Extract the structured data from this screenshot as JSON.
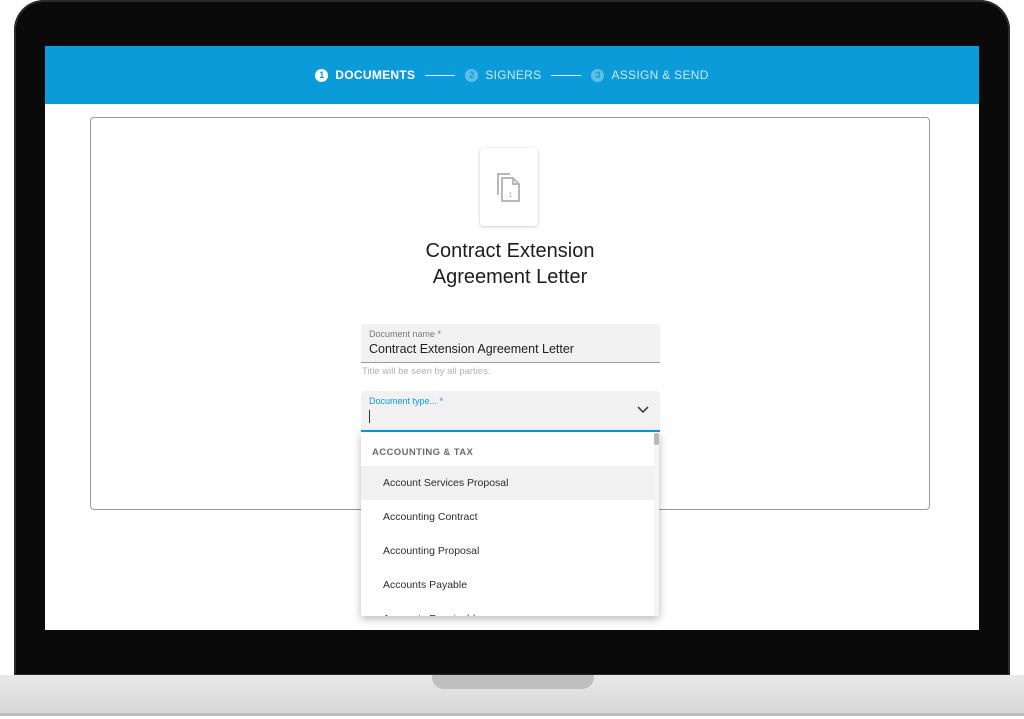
{
  "steps": [
    {
      "num": "1",
      "label": "DOCUMENTS",
      "state": "active"
    },
    {
      "num": "2",
      "label": "SIGNERS",
      "state": "inactive"
    },
    {
      "num": "3",
      "label": "ASSIGN & SEND",
      "state": "inactive"
    }
  ],
  "document": {
    "title_line1": "Contract Extension",
    "title_line2": "Agreement Letter",
    "icon": "documents-copy-icon"
  },
  "fields": {
    "name_label": "Document name *",
    "name_value": "Contract Extension Agreement Letter",
    "name_hint": "Title will be seen by all parties.",
    "type_label": "Document type... *",
    "type_value": ""
  },
  "dropdown": {
    "group": "ACCOUNTING & TAX",
    "items": [
      "Account Services Proposal",
      "Accounting Contract",
      "Accounting Proposal",
      "Accounts Payable",
      "Accounts Receivable"
    ]
  },
  "colors": {
    "accent": "#0a9bd8",
    "laptop_frame": "#0a0a0a"
  }
}
